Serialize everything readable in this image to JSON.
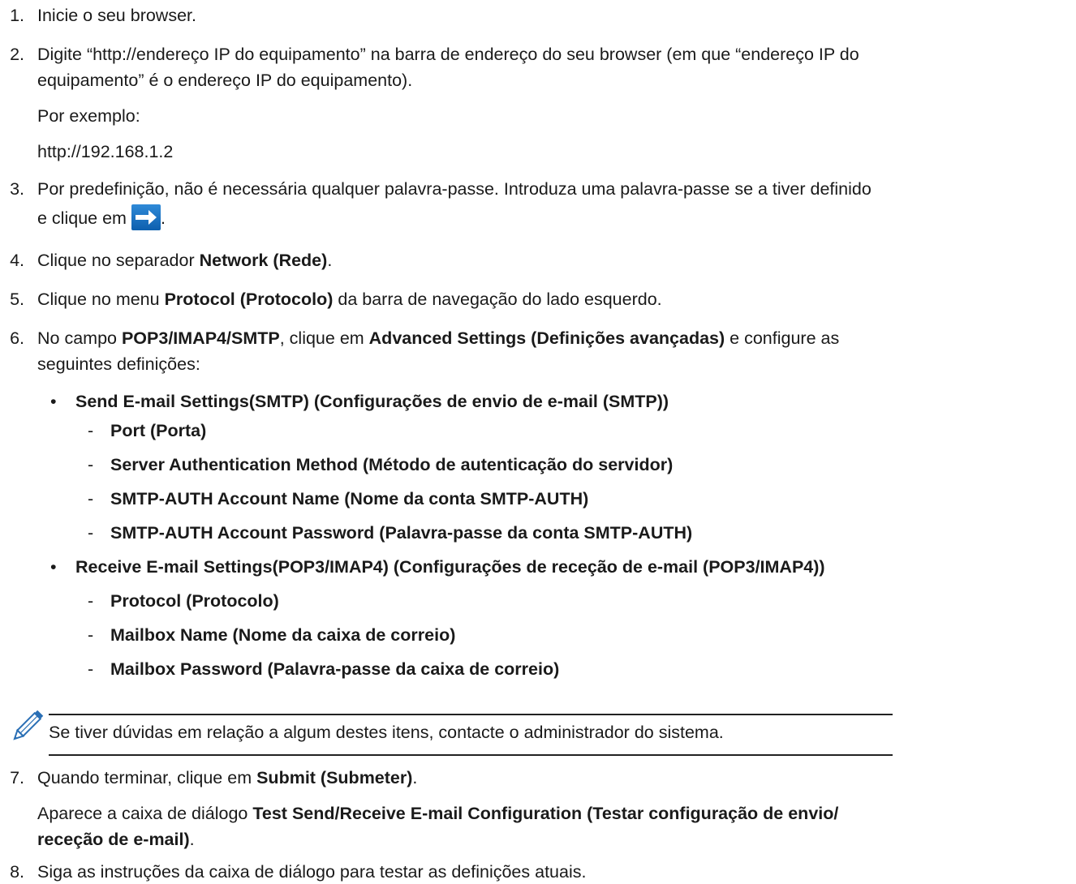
{
  "steps": {
    "s1": {
      "num": "1.",
      "text": "Inicie o seu browser."
    },
    "s2": {
      "num": "2.",
      "line1": "Digite “http://endereço IP do equipamento” na barra de endereço do seu browser (em que “endereço IP do",
      "line2": "equipamento” é o endereço IP do equipamento).",
      "example_label": "Por exemplo:",
      "example_url": "http://192.168.1.2"
    },
    "s3": {
      "num": "3.",
      "line1": "Por predefinição, não é necessária qualquer palavra-passe. Introduza uma palavra-passe se a tiver definido",
      "line2_pre": "e clique em",
      "line2_post": "."
    },
    "s4": {
      "num": "4.",
      "pre": "Clique no separador ",
      "bold": "Network (Rede)",
      "post": "."
    },
    "s5": {
      "num": "5.",
      "pre": "Clique no menu ",
      "bold": "Protocol (Protocolo)",
      "post": " da barra de navegação do lado esquerdo."
    },
    "s6": {
      "num": "6.",
      "pre": "No campo ",
      "bold1": "POP3/IMAP4/SMTP",
      "mid": ", clique em ",
      "bold2": "Advanced Settings (Definições avançadas)",
      "post": " e configure as",
      "line2": "seguintes definições:",
      "bullets": [
        {
          "label": "Send E-mail Settings(SMTP) (Configurações de envio de e-mail (SMTP))",
          "subs": [
            "Port (Porta)",
            "Server Authentication Method (Método de autenticação do servidor)",
            "SMTP-AUTH Account Name (Nome da conta SMTP-AUTH)",
            "SMTP-AUTH Account Password (Palavra-passe da conta SMTP-AUTH)"
          ]
        },
        {
          "label": "Receive E-mail Settings(POP3/IMAP4) (Configurações de receção de e-mail (POP3/IMAP4))",
          "subs": [
            "Protocol (Protocolo)",
            "Mailbox Name (Nome da caixa de correio)",
            "Mailbox Password (Palavra-passe da caixa de correio)"
          ]
        }
      ],
      "bullet_char": "•",
      "dash_char": "-"
    },
    "note": {
      "text": "Se tiver dúvidas em relação a algum destes itens, contacte o administrador do sistema.",
      "icon": "pencil-icon"
    },
    "s7": {
      "num": "7.",
      "pre": "Quando terminar, clique em ",
      "bold": "Submit (Submeter)",
      "post": ".",
      "l2_pre": "Aparece a caixa de diálogo ",
      "l2_bold": "Test Send/Receive E-mail Configuration (Testar configuração de envio/",
      "l3_bold": "receção de e-mail)",
      "l3_post": "."
    },
    "s8": {
      "num": "8.",
      "text": "Siga as instruções da caixa de diálogo para testar as definições atuais."
    }
  },
  "colors": {
    "text": "#1a1a1a",
    "button": "#1f74c4"
  }
}
